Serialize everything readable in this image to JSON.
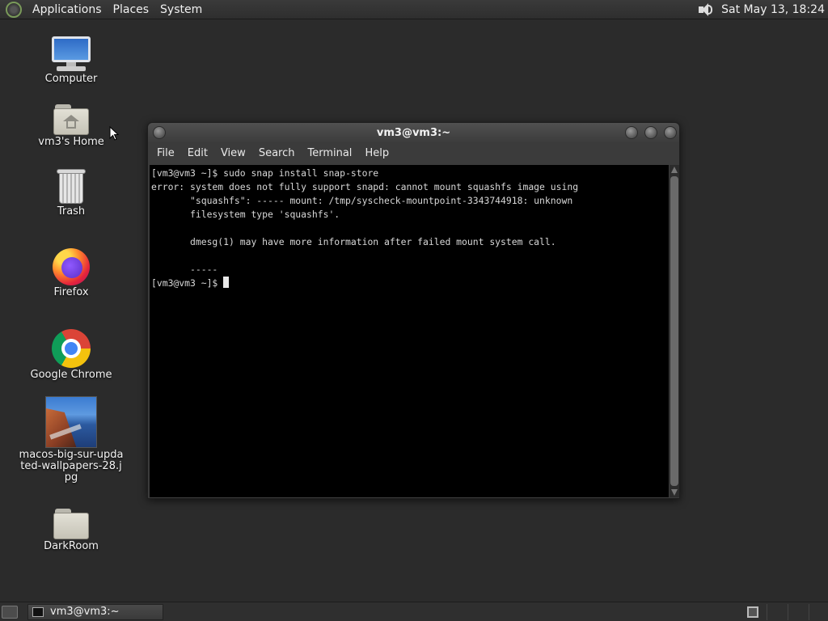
{
  "top_panel": {
    "menus": [
      "Applications",
      "Places",
      "System"
    ],
    "clock": "Sat May 13, 18:24"
  },
  "desktop": {
    "icons": [
      {
        "label": "Computer"
      },
      {
        "label": "vm3's Home"
      },
      {
        "label": "Trash"
      },
      {
        "label": "Firefox"
      },
      {
        "label": "Google Chrome"
      },
      {
        "label": "macos-big-sur-updated-wallpapers-28.jpg"
      },
      {
        "label": "DarkRoom"
      }
    ]
  },
  "terminal": {
    "title": "vm3@vm3:~",
    "menu": [
      "File",
      "Edit",
      "View",
      "Search",
      "Terminal",
      "Help"
    ],
    "lines": [
      "[vm3@vm3 ~]$ sudo snap install snap-store",
      "error: system does not fully support snapd: cannot mount squashfs image using",
      "       \"squashfs\": ----- mount: /tmp/syscheck-mountpoint-3343744918: unknown",
      "       filesystem type 'squashfs'.",
      "",
      "       dmesg(1) may have more information after failed mount system call.",
      "",
      "       -----"
    ],
    "prompt": "[vm3@vm3 ~]$ "
  },
  "taskbar": {
    "task_label": "vm3@vm3:~"
  }
}
